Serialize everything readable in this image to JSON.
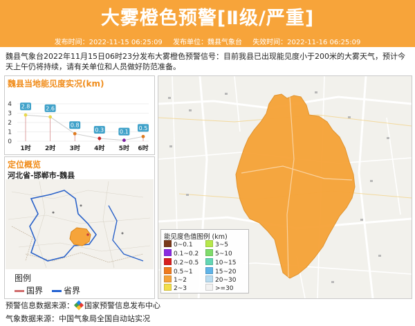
{
  "header": {
    "title": "大雾橙色预警[Ⅱ级/严重]",
    "publish_time": "发布时间：2022-11-15 06:25:09",
    "publisher": "发布单位：魏县气象台",
    "expire_time": "失效时间：2022-11-16 06:25:09"
  },
  "description": "魏县气象台2022年11月15日06时23分发布大雾橙色预警信号：目前我县已出现能见度小于200米的大雾天气，预计今天上午仍将持续，请有关单位和人员做好防范准备。",
  "visibility_panel": {
    "title": "魏县当地能见度实况(km)"
  },
  "chart_data": {
    "type": "line",
    "title": "魏县当地能见度实况(km)",
    "categories": [
      "1时",
      "2时",
      "3时",
      "4时",
      "5时",
      "6时"
    ],
    "values": [
      2.8,
      2.6,
      0.8,
      0.3,
      0.1,
      0.5
    ],
    "data_labels": [
      "2.8",
      "2.6",
      "0.8",
      "0.3",
      "0.1",
      "0.5"
    ],
    "y_ticks": [
      "0",
      "1",
      "2",
      "3",
      "4"
    ],
    "ylim": [
      0,
      4
    ],
    "point_colors": [
      "#e8d84c",
      "#e8d84c",
      "#e07a1e",
      "#c62828",
      "#7b1fa2",
      "#e07a1e"
    ],
    "grid": true
  },
  "location_panel": {
    "title": "定位概览",
    "path": "河北省-邯郸市-魏县",
    "legend_title": "图例",
    "legend_items": [
      {
        "label": "国界",
        "color": "#d06b6b"
      },
      {
        "label": "省界",
        "color": "#1f5fd1"
      }
    ]
  },
  "map_legend": {
    "title": "能见度色值图例 (km)",
    "items": [
      {
        "label": "0~0.1",
        "color": "#7a3a1a"
      },
      {
        "label": "0.1~0.2",
        "color": "#8a2be2"
      },
      {
        "label": "0.2~0.5",
        "color": "#d81f1f"
      },
      {
        "label": "0.5~1",
        "color": "#f07b1e"
      },
      {
        "label": "1~2",
        "color": "#f6a43a"
      },
      {
        "label": "2~3",
        "color": "#f3de4a"
      },
      {
        "label": "3~5",
        "color": "#b6e84a"
      },
      {
        "label": "5~10",
        "color": "#7fdc6a"
      },
      {
        "label": "10~15",
        "color": "#63d6b4"
      },
      {
        "label": "15~20",
        "color": "#5fb4e8"
      },
      {
        "label": "20~30",
        "color": "#b9dcf0"
      },
      {
        "label": ">=30",
        "color": "#f2f2f2"
      }
    ]
  },
  "footer": {
    "source_label": "预警信息数据来源：",
    "source_value": "国家预警信息发布中心",
    "weather_label": "气象数据来源：",
    "weather_value": "中国气象局全国自动站实况"
  }
}
